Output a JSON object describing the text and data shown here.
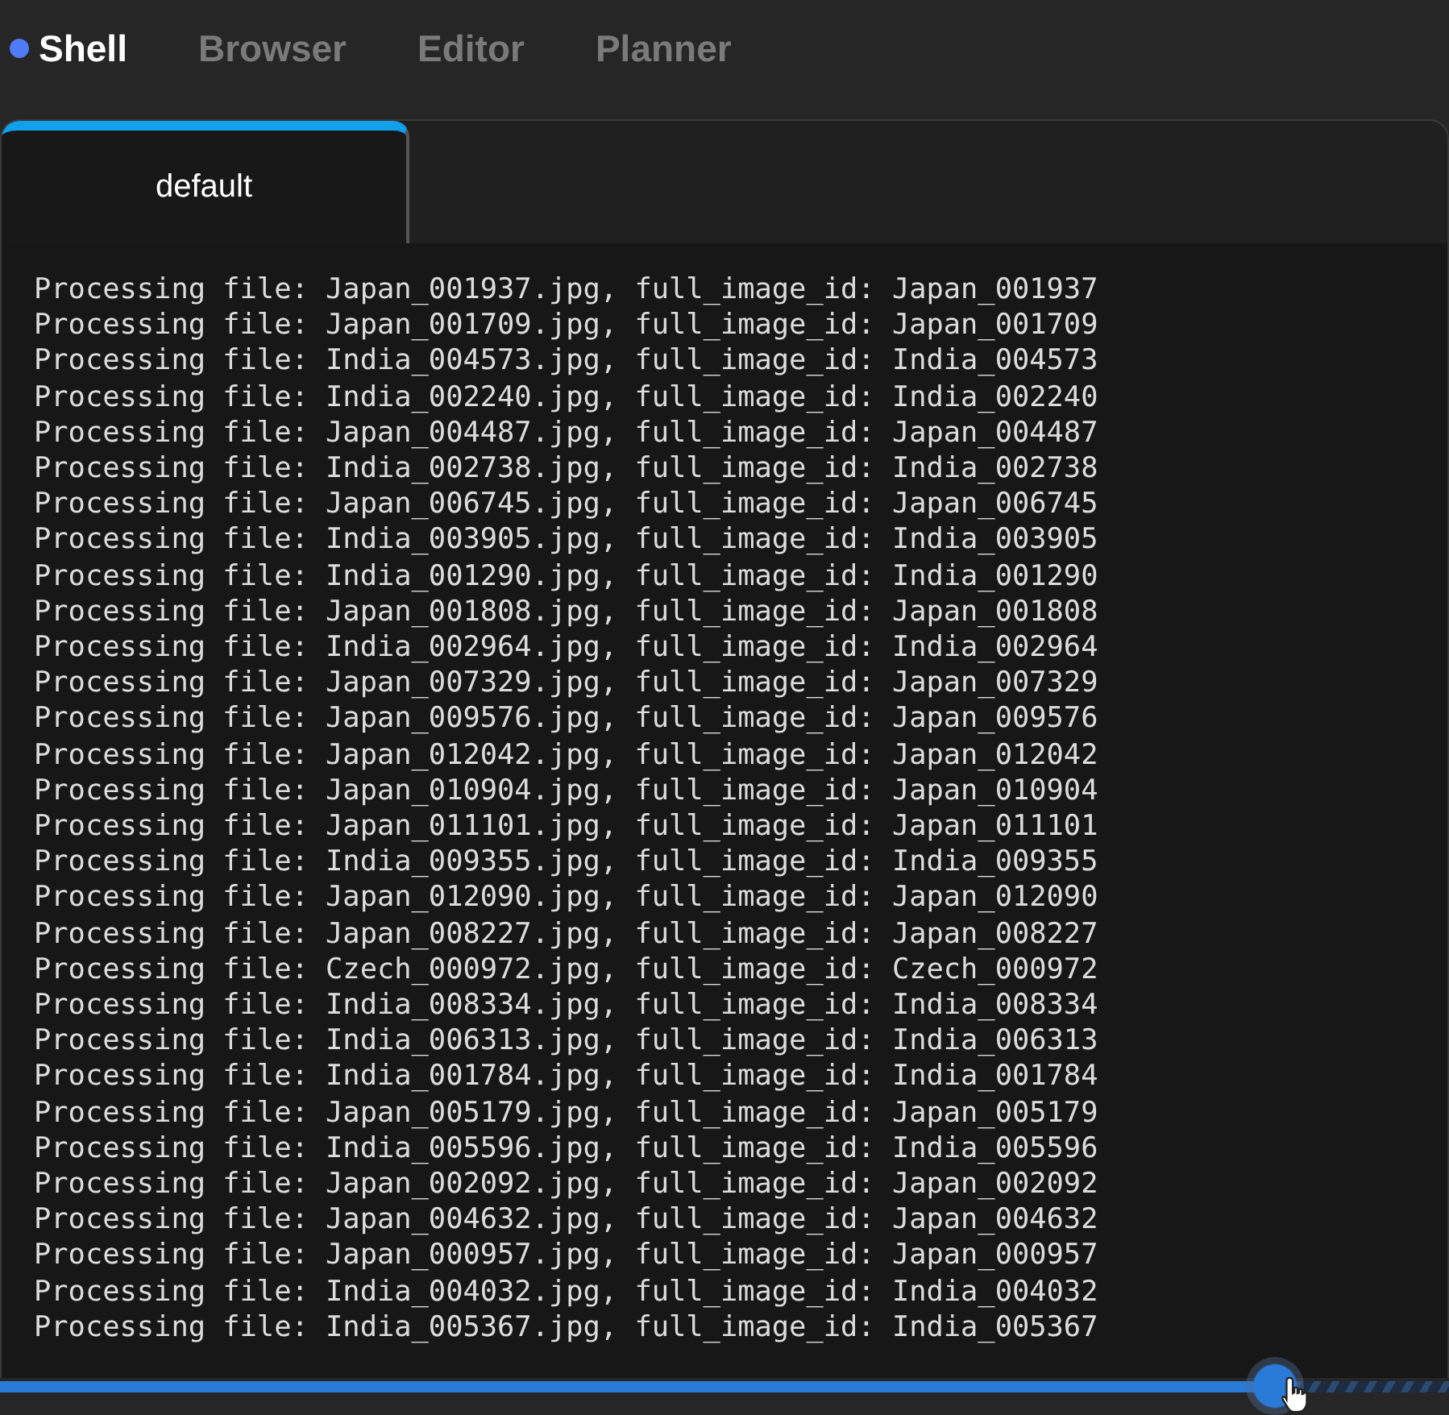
{
  "app_tabs": [
    {
      "label": "Shell",
      "selected": true
    },
    {
      "label": "Browser",
      "selected": false
    },
    {
      "label": "Editor",
      "selected": false
    },
    {
      "label": "Planner",
      "selected": false
    }
  ],
  "session_tabs": [
    {
      "label": "default",
      "selected": true
    }
  ],
  "terminal_lines": [
    "Processing file: Japan_001937.jpg, full_image_id: Japan_001937",
    "Processing file: Japan_001709.jpg, full_image_id: Japan_001709",
    "Processing file: India_004573.jpg, full_image_id: India_004573",
    "Processing file: India_002240.jpg, full_image_id: India_002240",
    "Processing file: Japan_004487.jpg, full_image_id: Japan_004487",
    "Processing file: India_002738.jpg, full_image_id: India_002738",
    "Processing file: Japan_006745.jpg, full_image_id: Japan_006745",
    "Processing file: India_003905.jpg, full_image_id: India_003905",
    "Processing file: India_001290.jpg, full_image_id: India_001290",
    "Processing file: Japan_001808.jpg, full_image_id: Japan_001808",
    "Processing file: India_002964.jpg, full_image_id: India_002964",
    "Processing file: Japan_007329.jpg, full_image_id: Japan_007329",
    "Processing file: Japan_009576.jpg, full_image_id: Japan_009576",
    "Processing file: Japan_012042.jpg, full_image_id: Japan_012042",
    "Processing file: Japan_010904.jpg, full_image_id: Japan_010904",
    "Processing file: Japan_011101.jpg, full_image_id: Japan_011101",
    "Processing file: India_009355.jpg, full_image_id: India_009355",
    "Processing file: Japan_012090.jpg, full_image_id: Japan_012090",
    "Processing file: Japan_008227.jpg, full_image_id: Japan_008227",
    "Processing file: Czech_000972.jpg, full_image_id: Czech_000972",
    "Processing file: India_008334.jpg, full_image_id: India_008334",
    "Processing file: India_006313.jpg, full_image_id: India_006313",
    "Processing file: India_001784.jpg, full_image_id: India_001784",
    "Processing file: Japan_005179.jpg, full_image_id: Japan_005179",
    "Processing file: India_005596.jpg, full_image_id: India_005596",
    "Processing file: Japan_002092.jpg, full_image_id: Japan_002092",
    "Processing file: Japan_004632.jpg, full_image_id: Japan_004632",
    "Processing file: Japan_000957.jpg, full_image_id: Japan_000957",
    "Processing file: India_004032.jpg, full_image_id: India_004032",
    "Processing file: India_005367.jpg, full_image_id: India_005367"
  ],
  "progress": {
    "level": 0.88
  }
}
